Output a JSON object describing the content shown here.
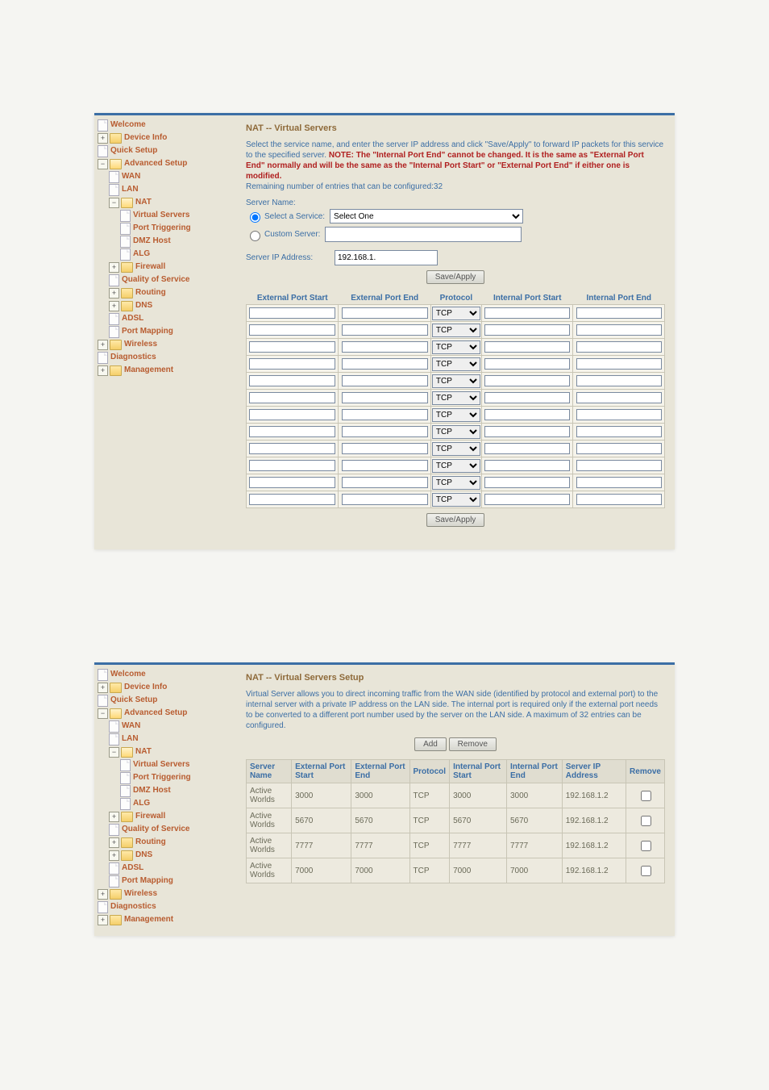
{
  "tree": {
    "welcome": "Welcome",
    "device_info": "Device Info",
    "quick_setup": "Quick Setup",
    "advanced_setup": "Advanced Setup",
    "wan": "WAN",
    "lan": "LAN",
    "nat": "NAT",
    "virtual_servers": "Virtual Servers",
    "port_triggering": "Port Triggering",
    "dmz_host": "DMZ Host",
    "alg": "ALG",
    "firewall": "Firewall",
    "qos": "Quality of Service",
    "routing": "Routing",
    "dns": "DNS",
    "adsl": "ADSL",
    "port_mapping": "Port Mapping",
    "wireless": "Wireless",
    "diagnostics": "Diagnostics",
    "management": "Management"
  },
  "panel1": {
    "title": "NAT -- Virtual Servers",
    "desc_pre": "Select the service name, and enter the server IP address and click \"Save/Apply\" to forward IP packets for this service to the specified server. ",
    "desc_note": "NOTE: The \"Internal Port End\" cannot be changed. It is the same as \"External Port End\" normally and will be the same as the \"Internal Port Start\" or \"External Port End\" if either one is modified.",
    "remaining": "Remaining number of entries that can be configured:32",
    "server_name_label": "Server Name:",
    "select_service_label": "Select a Service:",
    "select_service_value": "Select One",
    "custom_server_label": "Custom Server:",
    "server_ip_label": "Server IP Address:",
    "server_ip_value": "192.168.1.",
    "save_apply": "Save/Apply",
    "columns": {
      "ext_start": "External Port Start",
      "ext_end": "External Port End",
      "protocol": "Protocol",
      "int_start": "Internal Port Start",
      "int_end": "Internal Port End"
    },
    "protocol_default": "TCP",
    "row_count": 12
  },
  "panel2": {
    "title": "NAT -- Virtual Servers Setup",
    "desc": "Virtual Server allows you to direct incoming traffic from the WAN side (identified by protocol and external port) to the internal server with a private IP address on the LAN side. The internal port is required only if the external port needs to be converted to a different port number used by the server on the LAN side. A maximum of 32 entries can be configured.",
    "add": "Add",
    "remove": "Remove",
    "columns": {
      "server_name": "Server Name",
      "ext_start": "External Port Start",
      "ext_end": "External Port End",
      "protocol": "Protocol",
      "int_start": "Internal Port Start",
      "int_end": "Internal Port End",
      "server_ip": "Server IP Address",
      "remove_col": "Remove"
    },
    "rows": [
      {
        "name": "Active Worlds",
        "ext_start": "3000",
        "ext_end": "3000",
        "protocol": "TCP",
        "int_start": "3000",
        "int_end": "3000",
        "ip": "192.168.1.2"
      },
      {
        "name": "Active Worlds",
        "ext_start": "5670",
        "ext_end": "5670",
        "protocol": "TCP",
        "int_start": "5670",
        "int_end": "5670",
        "ip": "192.168.1.2"
      },
      {
        "name": "Active Worlds",
        "ext_start": "7777",
        "ext_end": "7777",
        "protocol": "TCP",
        "int_start": "7777",
        "int_end": "7777",
        "ip": "192.168.1.2"
      },
      {
        "name": "Active Worlds",
        "ext_start": "7000",
        "ext_end": "7000",
        "protocol": "TCP",
        "int_start": "7000",
        "int_end": "7000",
        "ip": "192.168.1.2"
      }
    ]
  }
}
